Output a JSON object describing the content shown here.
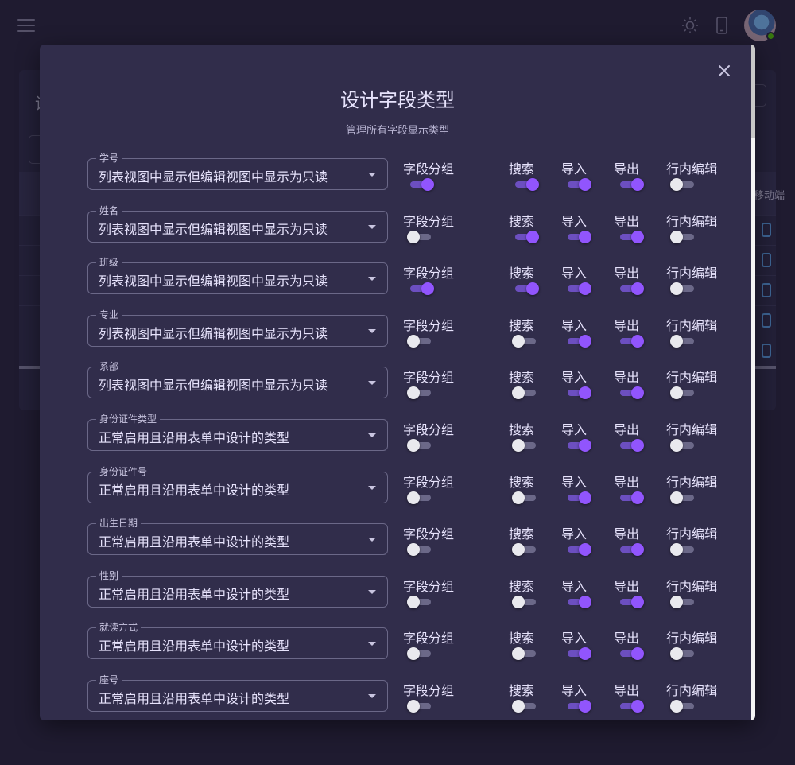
{
  "dialog": {
    "title": "设计字段类型",
    "subtitle": "管理所有字段显示类型",
    "columns": {
      "group": "字段分组",
      "search": "搜索",
      "import": "导入",
      "export": "导出",
      "inline_edit": "行内编辑"
    },
    "rows": [
      {
        "label": "学号",
        "value": "列表视图中显示但编辑视图中显示为只读",
        "group": true,
        "search": true,
        "import": true,
        "export": true,
        "inline_edit": false
      },
      {
        "label": "姓名",
        "value": "列表视图中显示但编辑视图中显示为只读",
        "group": false,
        "search": true,
        "import": true,
        "export": true,
        "inline_edit": false
      },
      {
        "label": "班级",
        "value": "列表视图中显示但编辑视图中显示为只读",
        "group": true,
        "search": true,
        "import": true,
        "export": true,
        "inline_edit": false
      },
      {
        "label": "专业",
        "value": "列表视图中显示但编辑视图中显示为只读",
        "group": false,
        "search": false,
        "import": true,
        "export": true,
        "inline_edit": false
      },
      {
        "label": "系部",
        "value": "列表视图中显示但编辑视图中显示为只读",
        "group": false,
        "search": false,
        "import": true,
        "export": true,
        "inline_edit": false
      },
      {
        "label": "身份证件类型",
        "value": "正常启用且沿用表单中设计的类型",
        "group": false,
        "search": false,
        "import": true,
        "export": true,
        "inline_edit": false
      },
      {
        "label": "身份证件号",
        "value": "正常启用且沿用表单中设计的类型",
        "group": false,
        "search": false,
        "import": true,
        "export": true,
        "inline_edit": false
      },
      {
        "label": "出生日期",
        "value": "正常启用且沿用表单中设计的类型",
        "group": false,
        "search": false,
        "import": true,
        "export": true,
        "inline_edit": false
      },
      {
        "label": "性别",
        "value": "正常启用且沿用表单中设计的类型",
        "group": false,
        "search": false,
        "import": true,
        "export": true,
        "inline_edit": false
      },
      {
        "label": "就读方式",
        "value": "正常启用且沿用表单中设计的类型",
        "group": false,
        "search": false,
        "import": true,
        "export": true,
        "inline_edit": false
      },
      {
        "label": "座号",
        "value": "正常启用且沿用表单中设计的类型",
        "group": false,
        "search": false,
        "import": true,
        "export": true,
        "inline_edit": false
      }
    ]
  },
  "background": {
    "title_fragment": "设",
    "column_fragment": "移动端"
  },
  "colors": {
    "accent": "#9155fd",
    "background": "#28243d",
    "surface": "#312d4b"
  }
}
